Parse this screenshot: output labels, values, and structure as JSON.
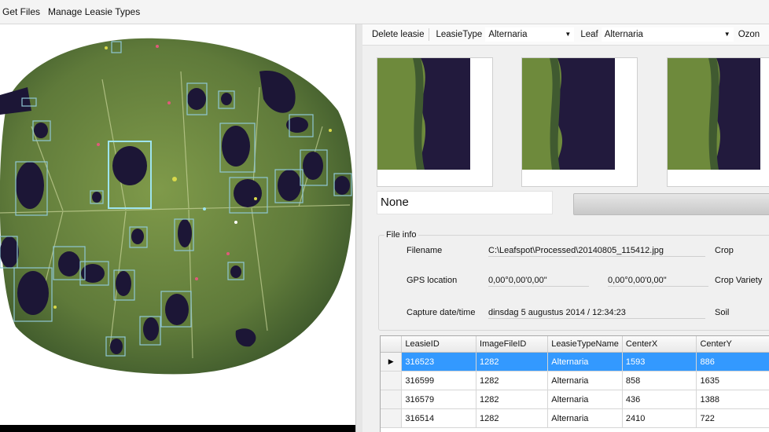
{
  "menu": {
    "items": [
      "Get Files",
      "Manage Leasie Types"
    ]
  },
  "toolbar": {
    "delete_label": "Delete leasie",
    "leasie_type_label": "LeasieType",
    "leasie_type_value": "Alternaria",
    "leaf_label": "Leaf",
    "leaf_value": "Alternaria",
    "ozon_label": "Ozon"
  },
  "status": {
    "text": "None"
  },
  "file_info": {
    "legend": "File info",
    "filename_label": "Filename",
    "filename_value": "C:\\Leafspot\\Processed\\20140805_115412.jpg",
    "crop_label": "Crop",
    "gps_label": "GPS location",
    "gps_value_1": "0,00°0,00'0,00\"",
    "gps_value_2": "0,00°0,00'0,00\"",
    "crop_variety_label": "Crop Variety",
    "capture_label": "Capture date/time",
    "capture_value": "dinsdag 5 augustus 2014 / 12:34:23",
    "soil_label": "Soil"
  },
  "grid": {
    "columns": [
      "LeasieID",
      "ImageFileID",
      "LeasieTypeName",
      "CenterX",
      "CenterY"
    ],
    "rows": [
      [
        "316523",
        "1282",
        "Alternaria",
        "1593",
        "886"
      ],
      [
        "316599",
        "1282",
        "Alternaria",
        "858",
        "1635"
      ],
      [
        "316579",
        "1282",
        "Alternaria",
        "436",
        "1388"
      ],
      [
        "316514",
        "1282",
        "Alternaria",
        "2410",
        "722"
      ]
    ],
    "selected_row": 0
  },
  "colors": {
    "selection": "#3399ff",
    "leaf_green": "#5f7a3a",
    "lesion": "#1c1636",
    "detection_box": "#8fc7d4"
  }
}
